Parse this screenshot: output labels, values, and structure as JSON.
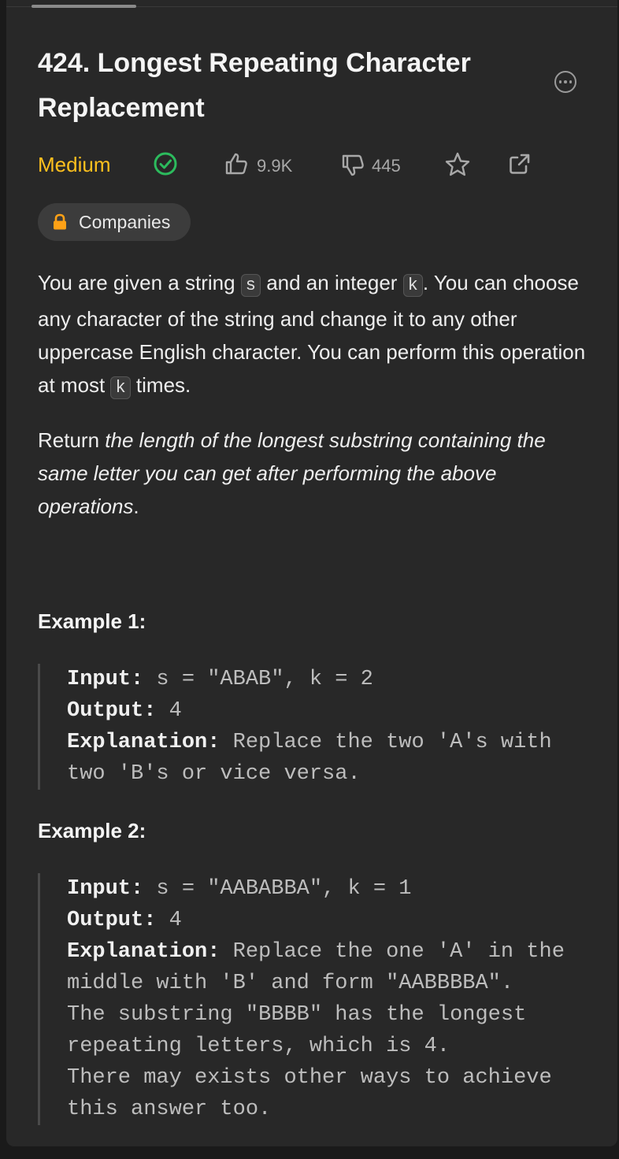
{
  "problem": {
    "title": "424. Longest Repeating Character Replacement",
    "difficulty": "Medium",
    "likes": "9.9K",
    "dislikes": "445",
    "companies_label": "Companies"
  },
  "icons": {
    "more": "more-options-icon",
    "solved": "check-circle-icon",
    "like": "thumbs-up-icon",
    "dislike": "thumbs-down-icon",
    "favorite": "star-icon",
    "share": "share-icon",
    "lock": "lock-icon"
  },
  "colors": {
    "difficulty": "#ffc01e",
    "solved": "#2cbb5d",
    "lock": "#ffa116"
  },
  "description": {
    "p1_a": "You are given a string ",
    "p1_code_s": "s",
    "p1_b": " and an integer ",
    "p1_code_k": "k",
    "p1_c": ". You can choose any character of the string and change it to any other uppercase English character. You can perform this operation at most ",
    "p1_code_k2": "k",
    "p1_d": " times.",
    "p2_a": "Return ",
    "p2_em": "the length of the longest substring containing the same letter you can get after performing the above operations",
    "p2_b": "."
  },
  "examples": [
    {
      "heading": "Example 1:",
      "input_label": "Input:",
      "input": " s = \"ABAB\", k = 2",
      "output_label": "Output:",
      "output": " 4",
      "explanation_label": "Explanation:",
      "explanation": " Replace the two 'A's with two 'B's or vice versa."
    },
    {
      "heading": "Example 2:",
      "input_label": "Input:",
      "input": " s = \"AABABBA\", k = 1",
      "output_label": "Output:",
      "output": " 4",
      "explanation_label": "Explanation:",
      "explanation": " Replace the one 'A' in the middle with 'B' and form \"AABBBBA\".\nThe substring \"BBBB\" has the longest repeating letters, which is 4.\nThere may exists other ways to achieve this answer too."
    }
  ]
}
